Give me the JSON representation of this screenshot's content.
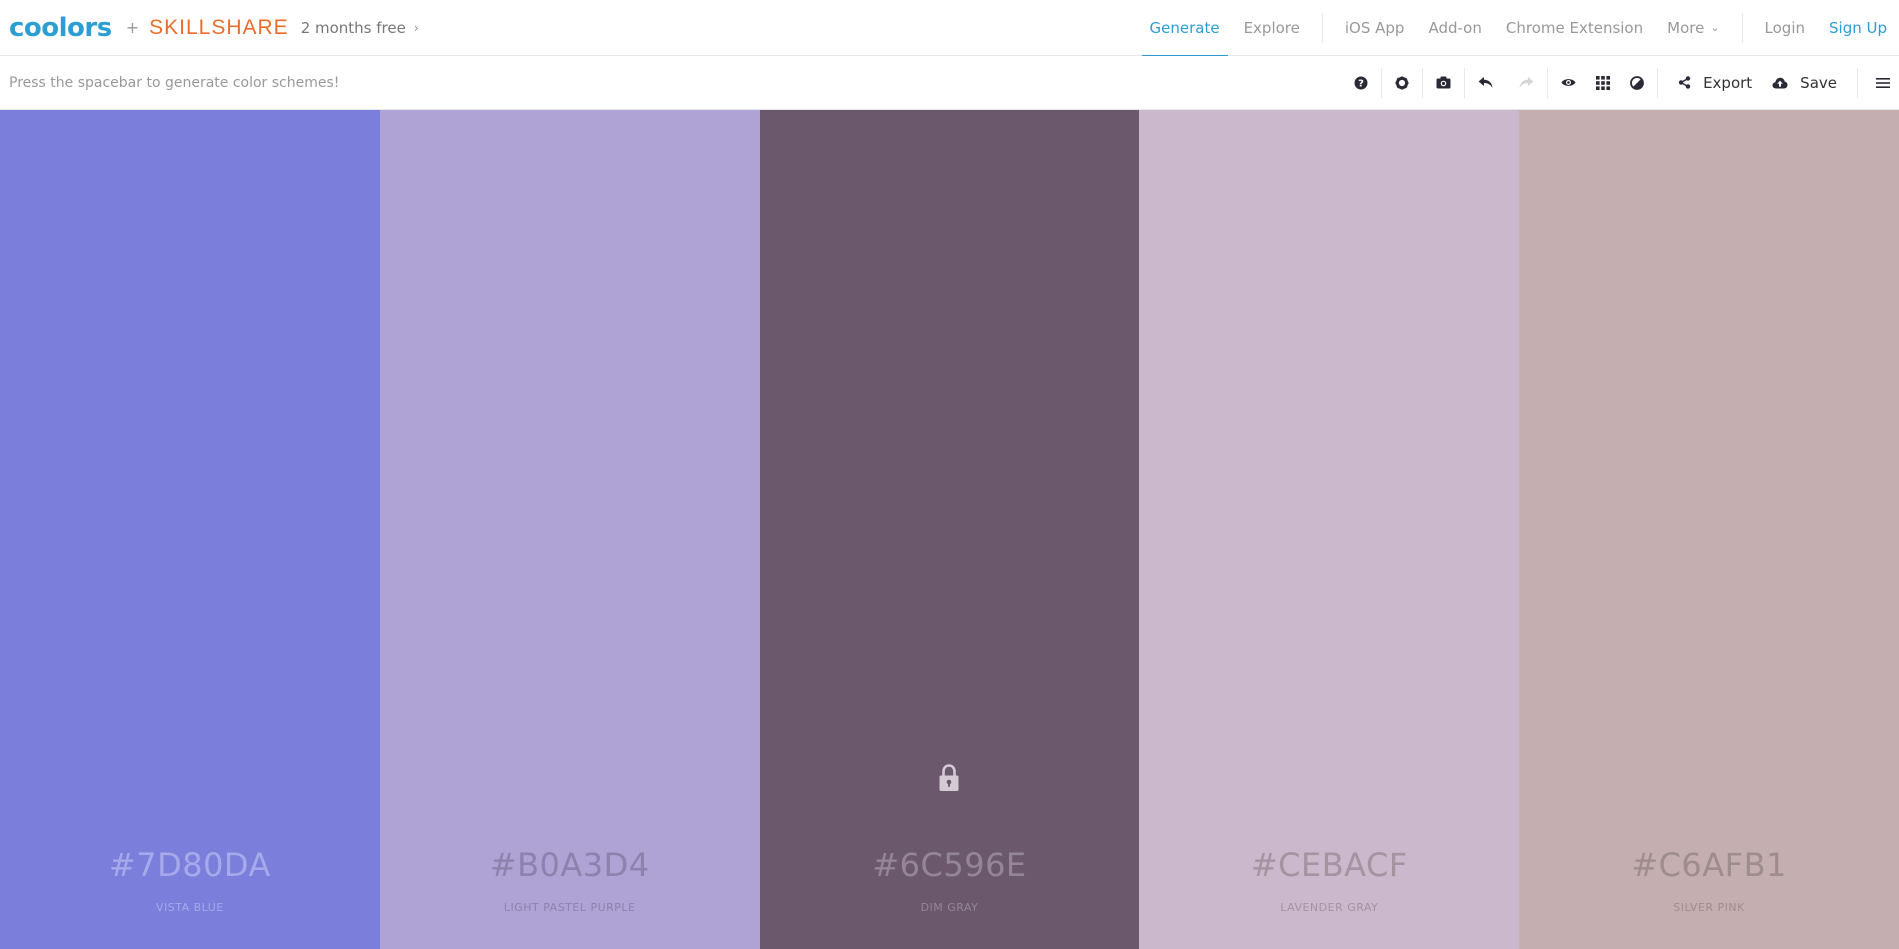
{
  "header": {
    "logo": "coolors",
    "plus": "+",
    "partner": "SKILLSHARE",
    "promo": "2 months free",
    "nav": [
      {
        "label": "Generate",
        "active": true
      },
      {
        "label": "Explore"
      },
      {
        "label": "iOS App"
      },
      {
        "label": "Add-on"
      },
      {
        "label": "Chrome Extension"
      },
      {
        "label": "More"
      },
      {
        "label": "Login"
      },
      {
        "label": "Sign Up"
      }
    ]
  },
  "toolbar": {
    "hint": "Press the spacebar to generate color schemes!",
    "export_label": "Export",
    "save_label": "Save",
    "icons": [
      "help-icon",
      "gear-icon",
      "camera-icon",
      "undo-icon",
      "redo-icon",
      "eye-icon",
      "grid-icon",
      "contrast-icon",
      "share-icon",
      "cloud-upload-icon",
      "hamburger-icon"
    ]
  },
  "palette": [
    {
      "hex": "#7D80DA",
      "name": "VISTA BLUE",
      "bg": "#7b7fdb",
      "text": "#a6a9ea",
      "locked": false
    },
    {
      "hex": "#B0A3D4",
      "name": "LIGHT PASTEL PURPLE",
      "bg": "#afa2d4",
      "text": "#8c82ae",
      "locked": false
    },
    {
      "hex": "#6C596E",
      "name": "DIM GRAY",
      "bg": "#6b586d",
      "text": "#958598",
      "locked": true
    },
    {
      "hex": "#CEBACF",
      "name": "LAVENDER GRAY",
      "bg": "#ccb8cd",
      "text": "#a3949f",
      "locked": false
    },
    {
      "hex": "#C6AFB1",
      "name": "SILVER PINK",
      "bg": "#c5aeb0",
      "text": "#9e8c8e",
      "locked": false
    }
  ]
}
